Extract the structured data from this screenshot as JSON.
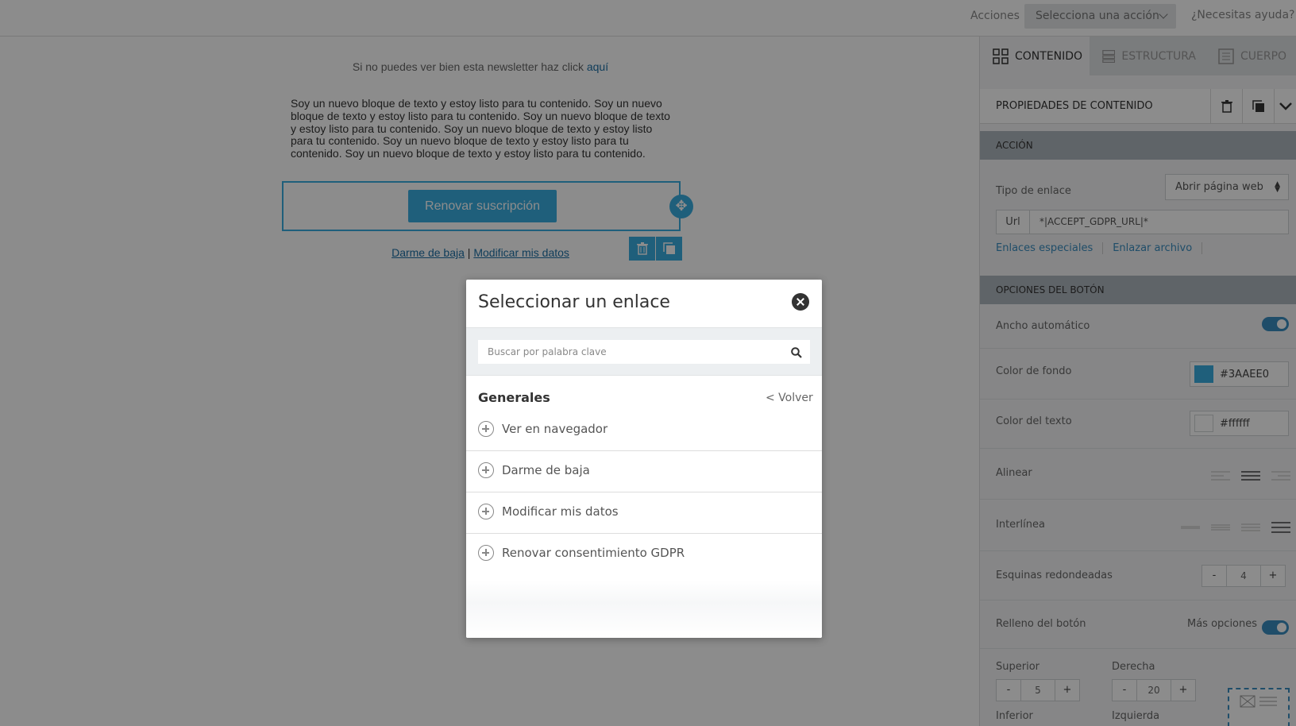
{
  "topbar": {
    "actions_label": "Acciones",
    "select_action": "Selecciona una acción",
    "help": "¿Necesitas ayuda?"
  },
  "canvas": {
    "webview_text": "Si no puedes ver bien esta newsletter haz click ",
    "webview_link": "aquí",
    "text_block": "Soy un nuevo bloque de texto y estoy listo para tu contenido. Soy un nuevo bloque de texto y estoy listo para tu contenido. Soy un nuevo bloque de texto y estoy listo para tu contenido. Soy un nuevo bloque de texto y estoy listo para tu contenido. Soy un nuevo bloque de texto y estoy listo para tu contenido. Soy un nuevo bloque de texto y estoy listo para tu contenido.",
    "button_label": "Renovar suscripción",
    "footer_link_1": "Darme de baja",
    "footer_separator": " | ",
    "footer_link_2": "Modificar mis datos"
  },
  "sidebar": {
    "tabs": [
      {
        "label": "CONTENIDO",
        "icon": "grid-icon",
        "active": true
      },
      {
        "label": "ESTRUCTURA",
        "icon": "rows-icon",
        "active": false
      },
      {
        "label": "CUERPO",
        "icon": "page-icon",
        "active": false
      }
    ],
    "properties_title": "PROPIEDADES DE CONTENIDO",
    "section_action": "ACCIÓN",
    "link_type_label": "Tipo de enlace",
    "link_type_value": "Abrir página web",
    "url_addon": "Url",
    "url_value": "*|ACCEPT_GDPR_URL|*",
    "special_links": "Enlaces especiales",
    "link_file": "Enlazar archivo",
    "section_button_options": "OPCIONES DEL BOTÓN",
    "auto_width_label": "Ancho automático",
    "auto_width_on": true,
    "bg_color_label": "Color de fondo",
    "bg_color_value": "#3AAEE0",
    "text_color_label": "Color del texto",
    "text_color_value": "#ffffff",
    "align_label": "Alinear",
    "line_height_label": "Interlínea",
    "rounded_label": "Esquinas redondeadas",
    "rounded_value": "4",
    "padding_label": "Relleno del botón",
    "more_options": "Más opciones",
    "more_options_on": true,
    "top_label": "Superior",
    "top_value": "5",
    "right_label": "Derecha",
    "right_value": "20",
    "bottom_label": "Inferior",
    "left_label": "Izquierda",
    "minus": "-",
    "plus": "+"
  },
  "modal": {
    "title": "Seleccionar un enlace",
    "search_placeholder": "Buscar por palabra clave",
    "group_title": "Generales",
    "back": "< Volver",
    "items": [
      "Ver en navegador",
      "Darme de baja",
      "Modificar mis datos",
      "Renovar consentimiento GDPR"
    ]
  },
  "colors": {
    "accent": "#3aaee0",
    "link": "#1d6fa5",
    "section_bar": "#aeb6bd"
  }
}
